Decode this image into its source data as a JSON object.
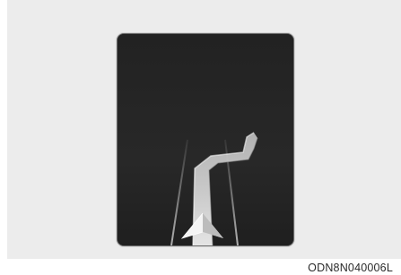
{
  "figure": {
    "code": "ODN8N040006L",
    "icons": {
      "screen": "navigation-guidance-display",
      "route": "route-path-icon",
      "vehicle": "vehicle-position-arrow-icon"
    },
    "colors": {
      "background": "#ececec",
      "screen": "#252525",
      "route": "#d9d9d9",
      "arrow": "#f2f2f2"
    }
  }
}
